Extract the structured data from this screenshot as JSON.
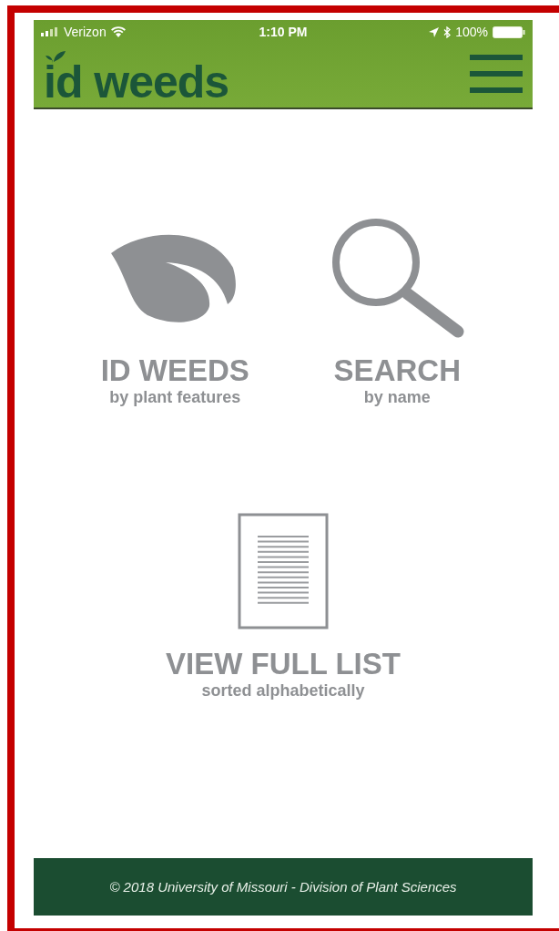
{
  "status_bar": {
    "carrier": "Verizon",
    "time": "1:10 PM",
    "battery": "100%"
  },
  "header": {
    "logo": "id weeds"
  },
  "actions": [
    {
      "kind": "leaf",
      "title": "ID WEEDS",
      "subtitle": "by plant features"
    },
    {
      "kind": "search",
      "title": "SEARCH",
      "subtitle": "by name"
    },
    {
      "kind": "list",
      "title": "VIEW FULL LIST",
      "subtitle": "sorted alphabetically"
    }
  ],
  "footer": {
    "text": "© 2018 University of Missouri - Division of Plant Sciences"
  }
}
